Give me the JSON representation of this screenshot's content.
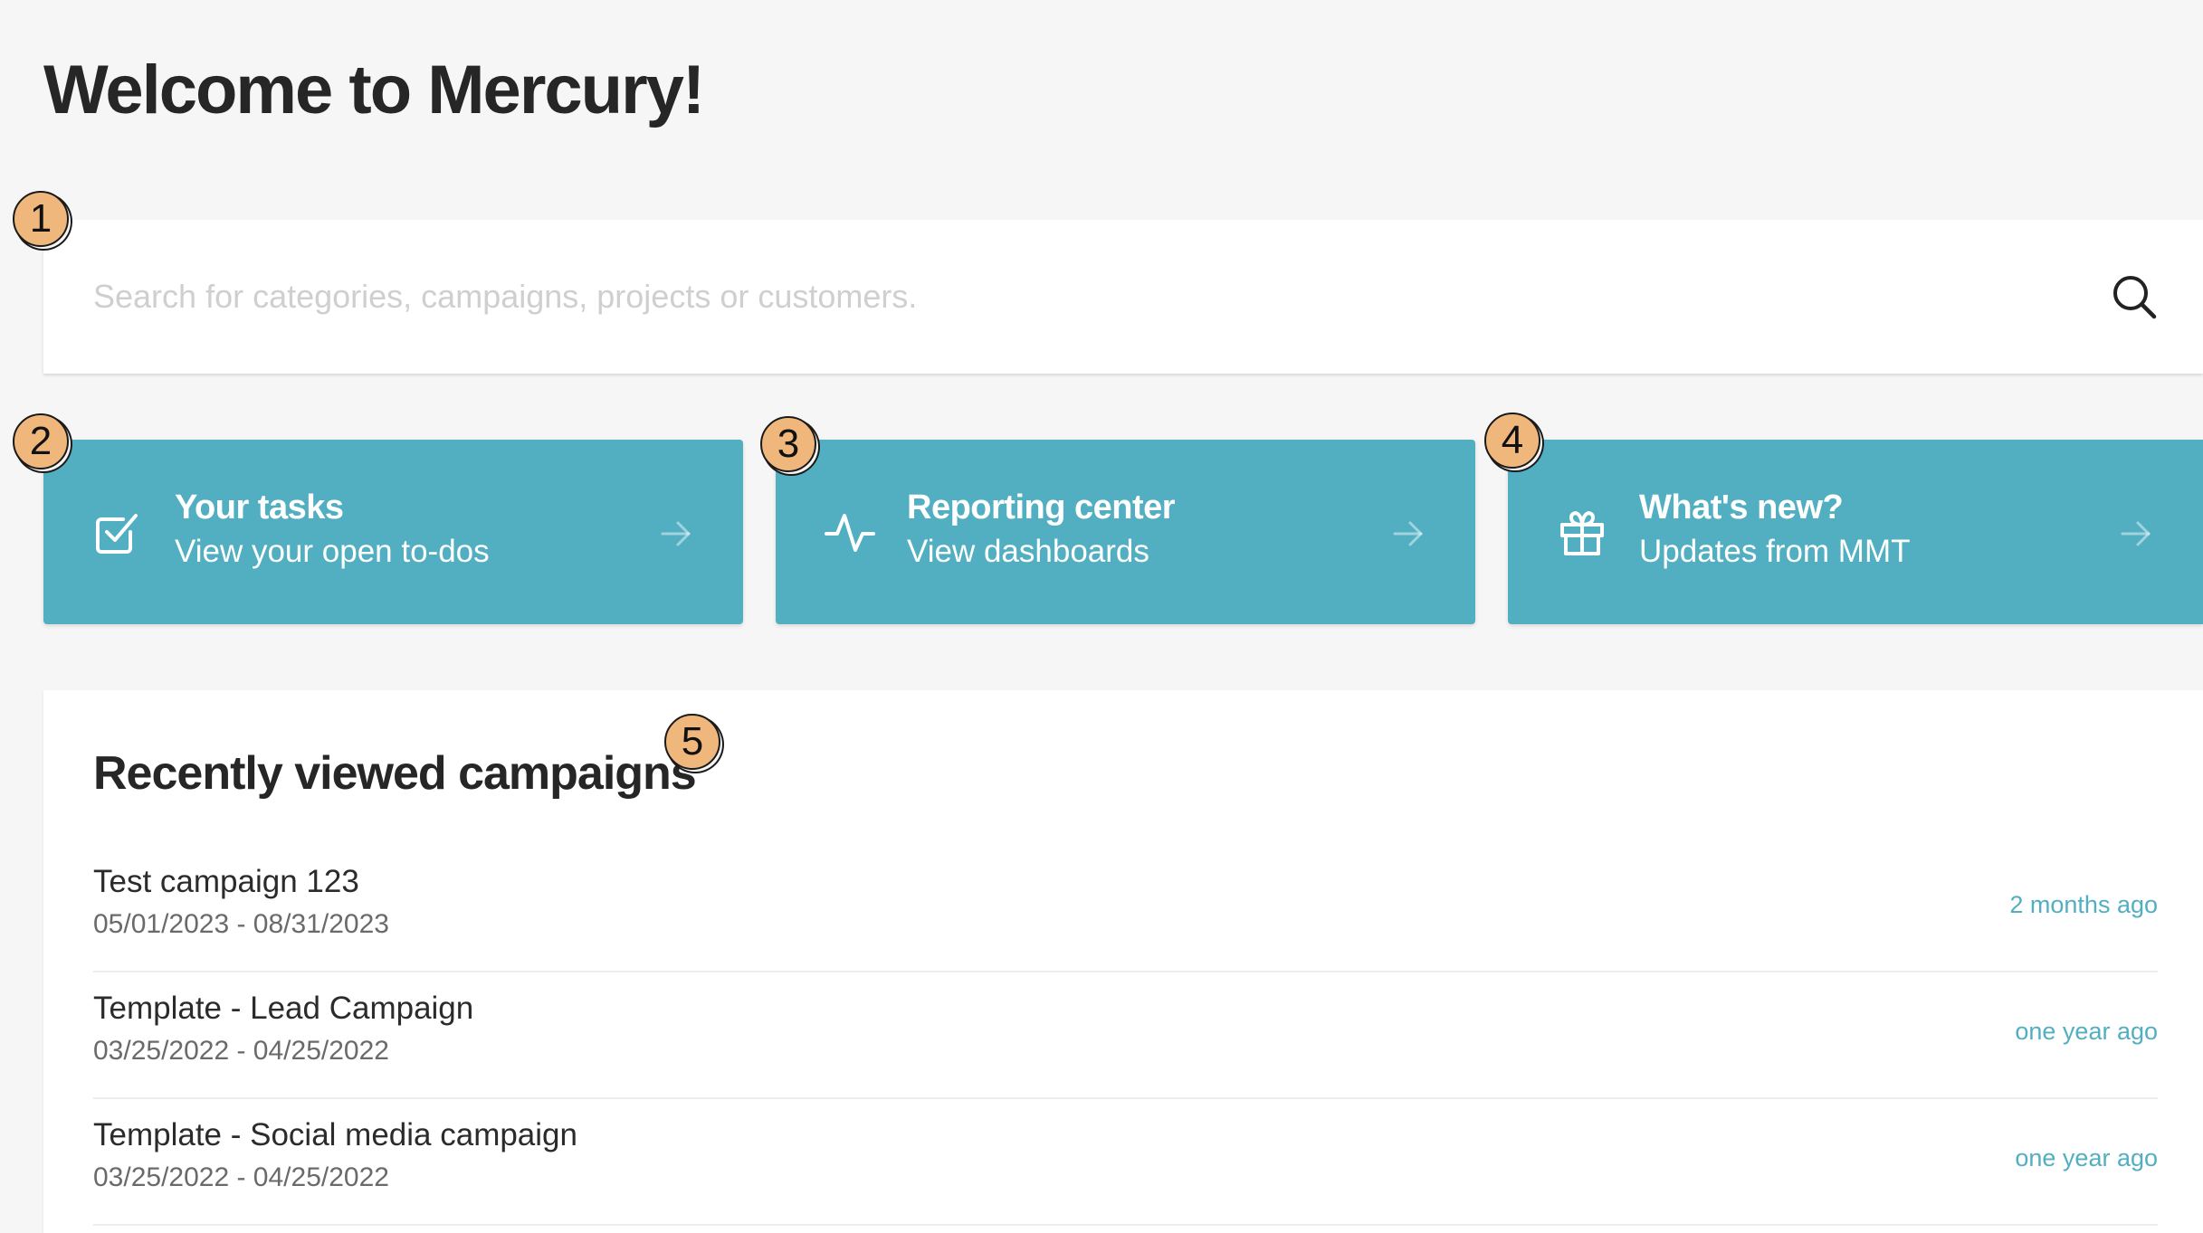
{
  "page": {
    "title": "Welcome to Mercury!"
  },
  "search": {
    "placeholder": "Search for categories, campaigns, projects or customers.",
    "value": "",
    "icon": "search-icon"
  },
  "cards": [
    {
      "title": "Your tasks",
      "subtitle": "View your open to-dos",
      "icon": "checkbox-icon"
    },
    {
      "title": "Reporting center",
      "subtitle": "View dashboards",
      "icon": "activity-icon"
    },
    {
      "title": "What's new?",
      "subtitle": "Updates from MMT",
      "icon": "gift-icon"
    }
  ],
  "markers": [
    "1",
    "2",
    "3",
    "4",
    "5"
  ],
  "recent": {
    "title": "Recently viewed campaigns",
    "items": [
      {
        "name": "Test campaign 123",
        "dates": "05/01/2023 - 08/31/2023",
        "time": "2 months ago"
      },
      {
        "name": "Template - Lead Campaign",
        "dates": "03/25/2022 - 04/25/2022",
        "time": "one year ago"
      },
      {
        "name": "Template - Social media campaign",
        "dates": "03/25/2022 - 04/25/2022",
        "time": "one year ago"
      }
    ]
  },
  "colors": {
    "background": "#f6f6f6",
    "card": "#52afc2",
    "accent_text": "#52afc2",
    "marker": "#f0b77c"
  }
}
